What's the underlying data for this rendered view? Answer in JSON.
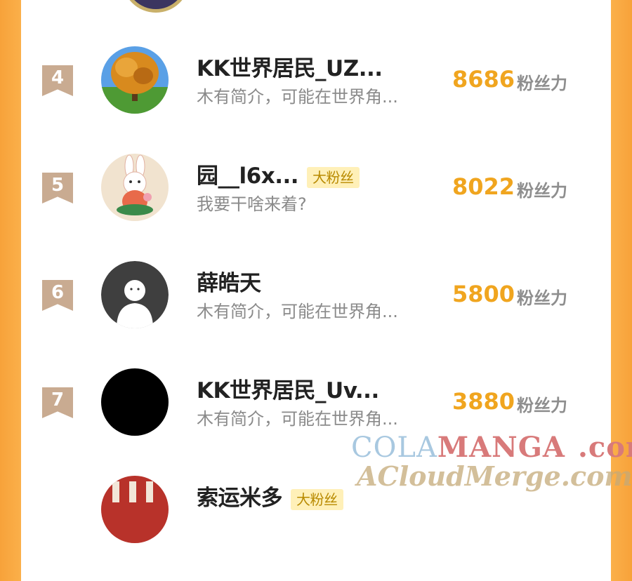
{
  "list": {
    "score_unit": "粉丝力",
    "rows": [
      {
        "rank": "4",
        "name": "KK世界居民_UZ...",
        "badge": "",
        "bio": "木有简介，可能在世界角...",
        "score": "8686",
        "avatar": "tree"
      },
      {
        "rank": "5",
        "name": "园__l6x...",
        "badge": "大粉丝",
        "bio": "我要干啥来着?",
        "score": "8022",
        "avatar": "bunny"
      },
      {
        "rank": "6",
        "name": "薛皓天",
        "badge": "",
        "bio": "木有简介，可能在世界角...",
        "score": "5800",
        "avatar": "default-person"
      },
      {
        "rank": "7",
        "name": "KK世界居民_Uv...",
        "badge": "",
        "bio": "木有简介，可能在世界角...",
        "score": "3880",
        "avatar": "black"
      },
      {
        "rank": "",
        "name": "索运米多",
        "badge": "大粉丝",
        "bio": "",
        "score": "",
        "avatar": "red-pattern"
      }
    ]
  },
  "watermark": {
    "line1_a": "COLA",
    "line1_b": "MANGA",
    "line1_c": ".com",
    "line2": "ACloudMerge.com"
  },
  "colors": {
    "accent": "#f0a51f",
    "side_orange": "#f7a23a",
    "rank_tag": "#c9ab91",
    "badge_bg": "#fff0b8"
  }
}
